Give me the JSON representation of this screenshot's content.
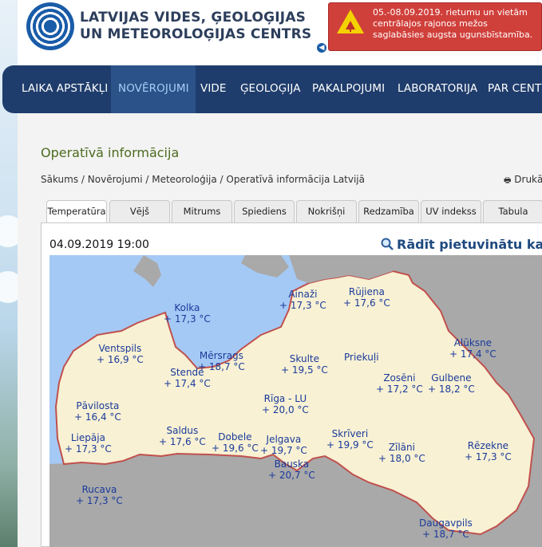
{
  "header": {
    "org_line1": "LATVIJAS VIDES, ĢEOLOĢIJAS",
    "org_line2": "UN METEOROLOĢIJAS CENTRS",
    "warning_text": "05.-08.09.2019. rietumu un vietām centrālajos rajonos mežos saglabāsies augsta ugunsbīstamība."
  },
  "nav": {
    "items": [
      "LAIKA APSTĀKĻI",
      "NOVĒROJUMI",
      "VIDE",
      "ĢEOLOĢIJA",
      "PAKALPOJUMI",
      "LABORATORIJA",
      "PAR CENTR"
    ],
    "active": "NOVĒROJUMI"
  },
  "page": {
    "title": "Operatīvā informācija",
    "breadcrumb": "Sākums / Novērojumi / Meteoroloģija / Operatīvā informācija Latvijā",
    "print_label": "Drukā"
  },
  "tabs": [
    "Temperatūra",
    "Vējš",
    "Mitrums",
    "Spiediens",
    "Nokrišņi",
    "Redzamība",
    "UV indekss",
    "Tabula"
  ],
  "active_tab": "Temperatūra",
  "map": {
    "datetime": "04.09.2019 19:00",
    "zoom_link": "Rādīt pietuvinātu karti",
    "cities": [
      {
        "name": "Ainaži",
        "temp": "+ 17,3 °C"
      },
      {
        "name": "Rūjiena",
        "temp": "+ 17,6 °C"
      },
      {
        "name": "Kolka",
        "temp": "+ 17,3 °C"
      },
      {
        "name": "Ventspils",
        "temp": "+ 16,9 °C"
      },
      {
        "name": "Mērsrags",
        "temp": "+ 18,7 °C"
      },
      {
        "name": "Stende",
        "temp": "+ 17,4 °C"
      },
      {
        "name": "Skulte",
        "temp": "+ 19,5 °C"
      },
      {
        "name": "Priekuļi",
        "temp": ""
      },
      {
        "name": "Alūksne",
        "temp": "+ 17,4 °C"
      },
      {
        "name": "Zosēni",
        "temp": "+ 17,2 °C"
      },
      {
        "name": "Gulbene",
        "temp": "+ 18,2 °C"
      },
      {
        "name": "Rīga - LU",
        "temp": "+ 20,0 °C"
      },
      {
        "name": "Pāvilosta",
        "temp": "+ 16,4 °C"
      },
      {
        "name": "Saldus",
        "temp": "+ 17,6 °C"
      },
      {
        "name": "Liepāja",
        "temp": "+ 17,3 °C"
      },
      {
        "name": "Dobele",
        "temp": "+ 19,6 °C"
      },
      {
        "name": "Jelgava",
        "temp": "+ 19,7 °C"
      },
      {
        "name": "Skrīveri",
        "temp": "+ 19,9 °C"
      },
      {
        "name": "Zīlāni",
        "temp": "+ 18,0 °C"
      },
      {
        "name": "Rēzekne",
        "temp": "+ 17,3 °C"
      },
      {
        "name": "Bauska",
        "temp": "+ 20,7 °C"
      },
      {
        "name": "Rucava",
        "temp": "+ 17,3 °C"
      },
      {
        "name": "Daugavpils",
        "temp": "+ 18,7 °C"
      }
    ]
  },
  "colors": {
    "nav_bg": "#1f3d6c",
    "warning_bg": "#d0403b",
    "sea": "#a5c9f5",
    "land": "#f8f1d4",
    "outside": "#a9a9a9",
    "border": "#c0504d",
    "city_text": "#1a3a9a"
  },
  "icons": [
    "logo-icon",
    "fire-warning-icon",
    "back-arrow-icon",
    "print-icon",
    "magnifier-icon"
  ]
}
